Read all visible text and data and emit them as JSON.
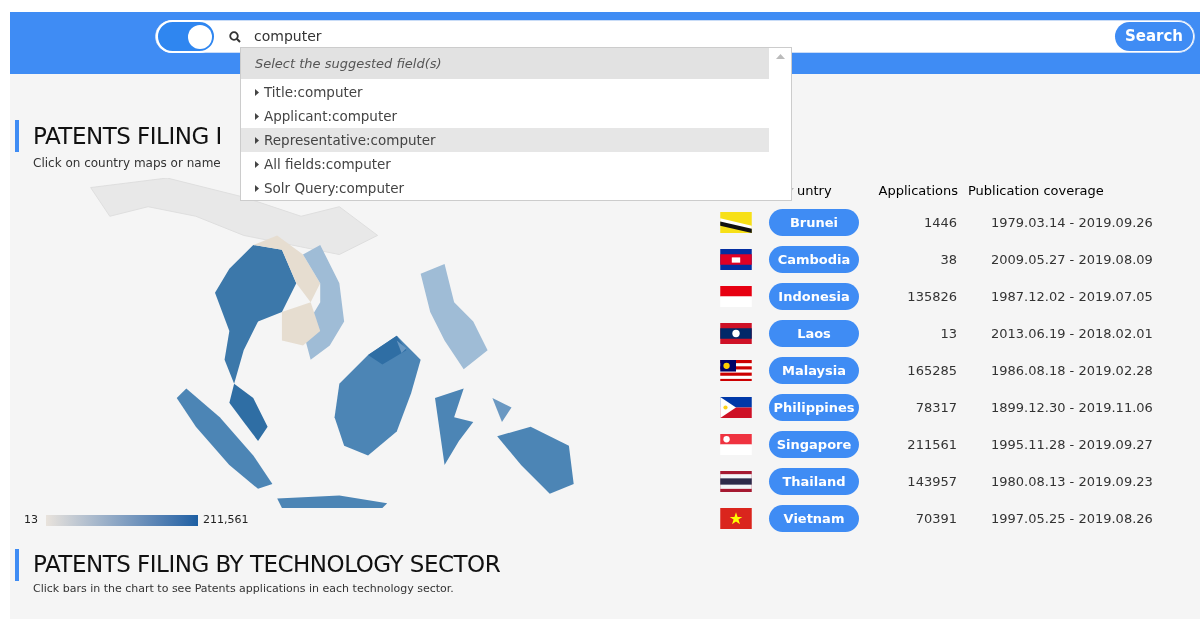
{
  "search": {
    "toggle_on": true,
    "value": "computer",
    "button": "Search"
  },
  "suggestions": {
    "header": "Select the suggested field(s)",
    "items": [
      {
        "label": "Title:computer",
        "selected": false
      },
      {
        "label": "Applicant:computer",
        "selected": false
      },
      {
        "label": "Representative:computer",
        "selected": true
      },
      {
        "label": "All fields:computer",
        "selected": false
      },
      {
        "label": "Solr Query:computer",
        "selected": false
      }
    ]
  },
  "map_section": {
    "title": "PATENTS FILING I",
    "subtitle": "Click on country maps or name",
    "legend": {
      "min": "13",
      "max": "211,561"
    },
    "table": {
      "columns": [
        "untry",
        "Applications",
        "Publication coverage"
      ],
      "rows": [
        {
          "country": "Brunei",
          "applications": "1446",
          "coverage": "1979.03.14 - 2019.09.26"
        },
        {
          "country": "Cambodia",
          "applications": "38",
          "coverage": "2009.05.27 - 2019.08.09"
        },
        {
          "country": "Indonesia",
          "applications": "135826",
          "coverage": "1987.12.02 - 2019.07.05"
        },
        {
          "country": "Laos",
          "applications": "13",
          "coverage": "2013.06.19 - 2018.02.01"
        },
        {
          "country": "Malaysia",
          "applications": "165285",
          "coverage": "1986.08.18 - 2019.02.28"
        },
        {
          "country": "Philippines",
          "applications": "78317",
          "coverage": "1899.12.30 - 2019.11.06"
        },
        {
          "country": "Singapore",
          "applications": "211561",
          "coverage": "1995.11.28 - 2019.09.27"
        },
        {
          "country": "Thailand",
          "applications": "143957",
          "coverage": "1980.08.13 - 2019.09.23"
        },
        {
          "country": "Vietnam",
          "applications": "70391",
          "coverage": "1997.05.25 - 2019.08.26"
        }
      ]
    }
  },
  "sector_section": {
    "title": "PATENTS FILING BY TECHNOLOGY SECTOR",
    "subtitle": "Click bars in the chart to see Patents applications in each technology sector."
  }
}
